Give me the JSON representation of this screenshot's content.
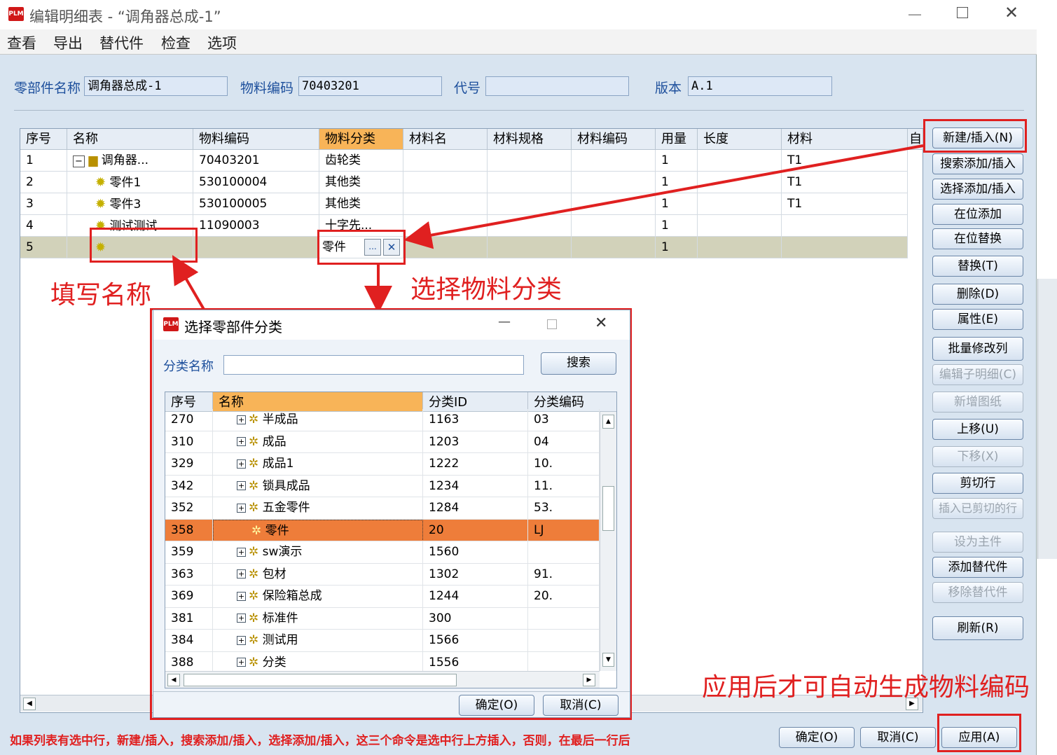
{
  "window": {
    "title": "编辑明细表 - “调角器总成-1”",
    "logo": "PLM"
  },
  "menu": [
    "查看",
    "导出",
    "替代件",
    "检查",
    "选项"
  ],
  "fields": {
    "part_name_label": "零部件名称",
    "part_name_value": "调角器总成-1",
    "material_code_label": "物料编码",
    "material_code_value": "70403201",
    "code_label": "代号",
    "code_value": "",
    "version_label": "版本",
    "version_value": "A.1"
  },
  "grid": {
    "columns": [
      "序号",
      "名称",
      "物料编码",
      "物料分类",
      "材料名",
      "材料规格",
      "材料编码",
      "用量",
      "长度",
      "材料",
      "自"
    ],
    "rows": [
      {
        "seq": "1",
        "name": "调角器...",
        "code": "70403201",
        "category": "齿轮类",
        "qty": "1",
        "material": "T1"
      },
      {
        "seq": "2",
        "name": "零件1",
        "code": "530100004",
        "category": "其他类",
        "qty": "1",
        "material": "T1"
      },
      {
        "seq": "3",
        "name": "零件3",
        "code": "530100005",
        "category": "其他类",
        "qty": "1",
        "material": "T1"
      },
      {
        "seq": "4",
        "name": "测试测试",
        "code": "11090003",
        "category": "十字先...",
        "qty": "1",
        "material": ""
      },
      {
        "seq": "5",
        "name": "",
        "code": "",
        "category": "零件",
        "qty": "1",
        "material": ""
      }
    ],
    "editor_ellipsis": "...",
    "editor_clear": "✕"
  },
  "side_buttons": [
    {
      "label": "新建/插入(N)",
      "enabled": true
    },
    {
      "label": "搜索添加/插入",
      "enabled": true
    },
    {
      "label": "选择添加/插入",
      "enabled": true
    },
    {
      "label": "在位添加",
      "enabled": true
    },
    {
      "label": "在位替换",
      "enabled": true
    },
    {
      "label": "替换(T)",
      "enabled": true
    },
    {
      "label": "删除(D)",
      "enabled": true
    },
    {
      "label": "属性(E)",
      "enabled": true
    },
    {
      "label": "批量修改列",
      "enabled": true
    },
    {
      "label": "编辑子明细(C)",
      "enabled": false
    },
    {
      "label": "新增图纸",
      "enabled": false
    },
    {
      "label": "上移(U)",
      "enabled": true
    },
    {
      "label": "下移(X)",
      "enabled": false
    },
    {
      "label": "剪切行",
      "enabled": true
    },
    {
      "label": "插入已剪切的行",
      "enabled": false
    },
    {
      "label": "设为主件",
      "enabled": false
    },
    {
      "label": "添加替代件",
      "enabled": true
    },
    {
      "label": "移除替代件",
      "enabled": false
    },
    {
      "label": "刷新(R)",
      "enabled": true
    }
  ],
  "annotations": {
    "fill_name": "填写名称",
    "select_category": "选择物料分类",
    "apply_note": "应用后才可自动生成物料编码"
  },
  "dialog": {
    "title": "选择零部件分类",
    "search_label": "分类名称",
    "search_value": "",
    "search_button": "搜索",
    "columns": [
      "序号",
      "名称",
      "分类ID",
      "分类编码"
    ],
    "rows": [
      {
        "seq": "270",
        "name": "半成品",
        "id": "1163",
        "code": "03"
      },
      {
        "seq": "310",
        "name": "成品",
        "id": "1203",
        "code": "04"
      },
      {
        "seq": "329",
        "name": "成品1",
        "id": "1222",
        "code": "10."
      },
      {
        "seq": "342",
        "name": "锁具成品",
        "id": "1234",
        "code": "11."
      },
      {
        "seq": "352",
        "name": "五金零件",
        "id": "1284",
        "code": "53."
      },
      {
        "seq": "358",
        "name": "零件",
        "id": "20",
        "code": "LJ",
        "selected": true
      },
      {
        "seq": "359",
        "name": "sw演示",
        "id": "1560",
        "code": ""
      },
      {
        "seq": "363",
        "name": "包材",
        "id": "1302",
        "code": "91."
      },
      {
        "seq": "369",
        "name": "保险箱总成",
        "id": "1244",
        "code": "20."
      },
      {
        "seq": "381",
        "name": "标准件",
        "id": "300",
        "code": ""
      },
      {
        "seq": "384",
        "name": "测试用",
        "id": "1566",
        "code": ""
      },
      {
        "seq": "388",
        "name": "分类",
        "id": "1556",
        "code": ""
      }
    ],
    "ok_button": "确定(O)",
    "cancel_button": "取消(C)"
  },
  "footer": {
    "hint": "如果列表有选中行，新建/插入，搜索添加/插入，选择添加/插入，这三个命令是选中行上方插入，否则，在最后一行后",
    "ok": "确定(O)",
    "cancel": "取消(C)",
    "apply": "应用(A)"
  }
}
